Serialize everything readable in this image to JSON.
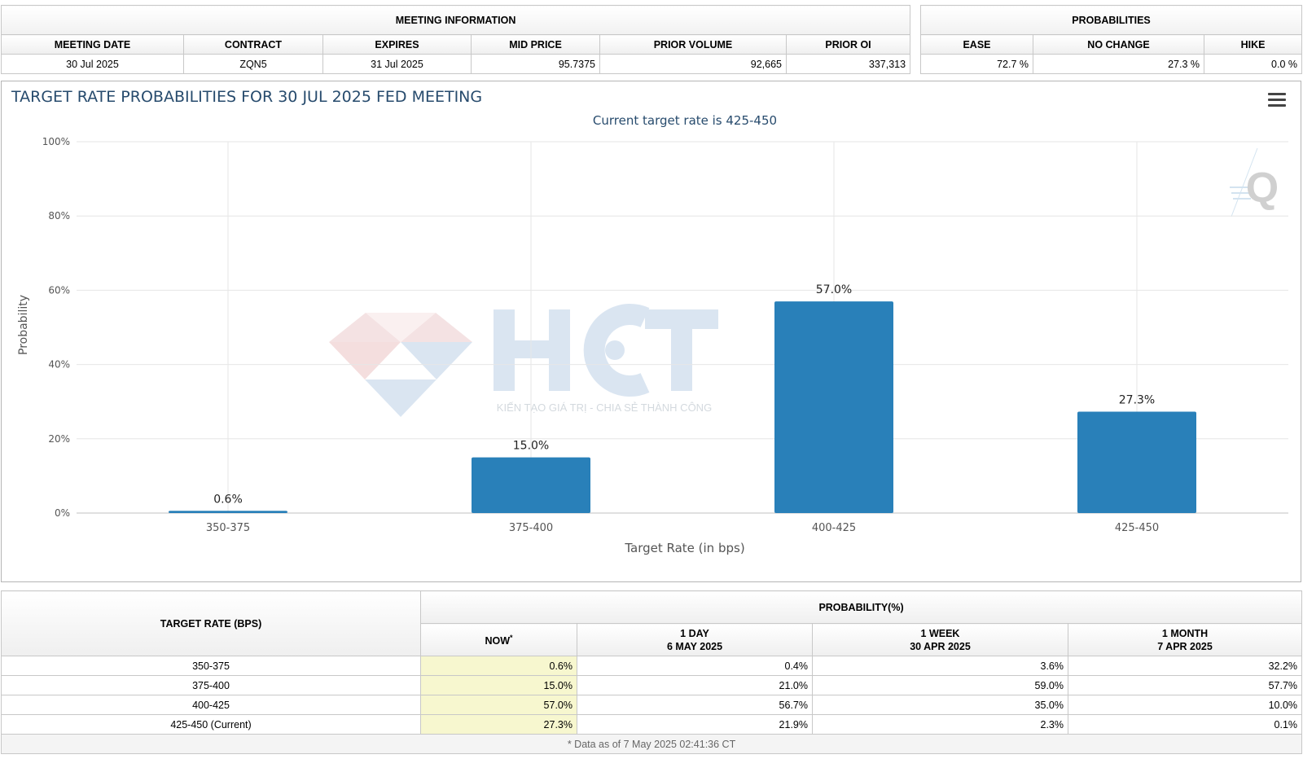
{
  "meeting_info": {
    "group_title": "MEETING INFORMATION",
    "headers": [
      "MEETING DATE",
      "CONTRACT",
      "EXPIRES",
      "MID PRICE",
      "PRIOR VOLUME",
      "PRIOR OI"
    ],
    "values": [
      "30 Jul 2025",
      "ZQN5",
      "31 Jul 2025",
      "95.7375",
      "92,665",
      "337,313"
    ]
  },
  "probabilities": {
    "group_title": "PROBABILITIES",
    "headers": [
      "EASE",
      "NO CHANGE",
      "HIKE"
    ],
    "values": [
      "72.7 %",
      "27.3 %",
      "0.0 %"
    ]
  },
  "chart": {
    "menu_icon": "hamburger-menu-icon",
    "watermark_text": "HCT",
    "watermark_tagline": "KIẾN TẠO GIÁ TRỊ - CHIA SẺ THÀNH CÔNG",
    "corner_logo": "Q",
    "colors": {
      "bar": "#2980b9",
      "title": "#274b6d",
      "grid": "#e6e6e6",
      "axis_text": "#555555"
    }
  },
  "chart_data": {
    "type": "bar",
    "title": "TARGET RATE PROBABILITIES FOR 30 JUL 2025 FED MEETING",
    "subtitle": "Current target rate is 425-450",
    "xlabel": "Target Rate (in bps)",
    "ylabel": "Probability",
    "categories": [
      "350-375",
      "375-400",
      "400-425",
      "425-450"
    ],
    "values": [
      0.6,
      15.0,
      57.0,
      27.3
    ],
    "data_labels": [
      "0.6%",
      "15.0%",
      "57.0%",
      "27.3%"
    ],
    "ylim": [
      0,
      100
    ],
    "yticks": [
      "0%",
      "20%",
      "40%",
      "60%",
      "80%",
      "100%"
    ],
    "grid": true
  },
  "bottom_table": {
    "target_rate_header": "TARGET RATE (BPS)",
    "probability_header": "PROBABILITY(%)",
    "columns": [
      {
        "line1": "NOW",
        "line2": ""
      },
      {
        "line1": "1 DAY",
        "line2": "6 MAY 2025"
      },
      {
        "line1": "1 WEEK",
        "line2": "30 APR 2025"
      },
      {
        "line1": "1 MONTH",
        "line2": "7 APR 2025"
      }
    ],
    "now_marker": "*",
    "rows": [
      {
        "rate": "350-375",
        "now": "0.6%",
        "day": "0.4%",
        "week": "3.6%",
        "month": "32.2%"
      },
      {
        "rate": "375-400",
        "now": "15.0%",
        "day": "21.0%",
        "week": "59.0%",
        "month": "57.7%"
      },
      {
        "rate": "400-425",
        "now": "57.0%",
        "day": "56.7%",
        "week": "35.0%",
        "month": "10.0%"
      },
      {
        "rate": "425-450 (Current)",
        "now": "27.3%",
        "day": "21.9%",
        "week": "2.3%",
        "month": "0.1%"
      }
    ],
    "footnote": "* Data as of 7 May 2025 02:41:36 CT"
  }
}
